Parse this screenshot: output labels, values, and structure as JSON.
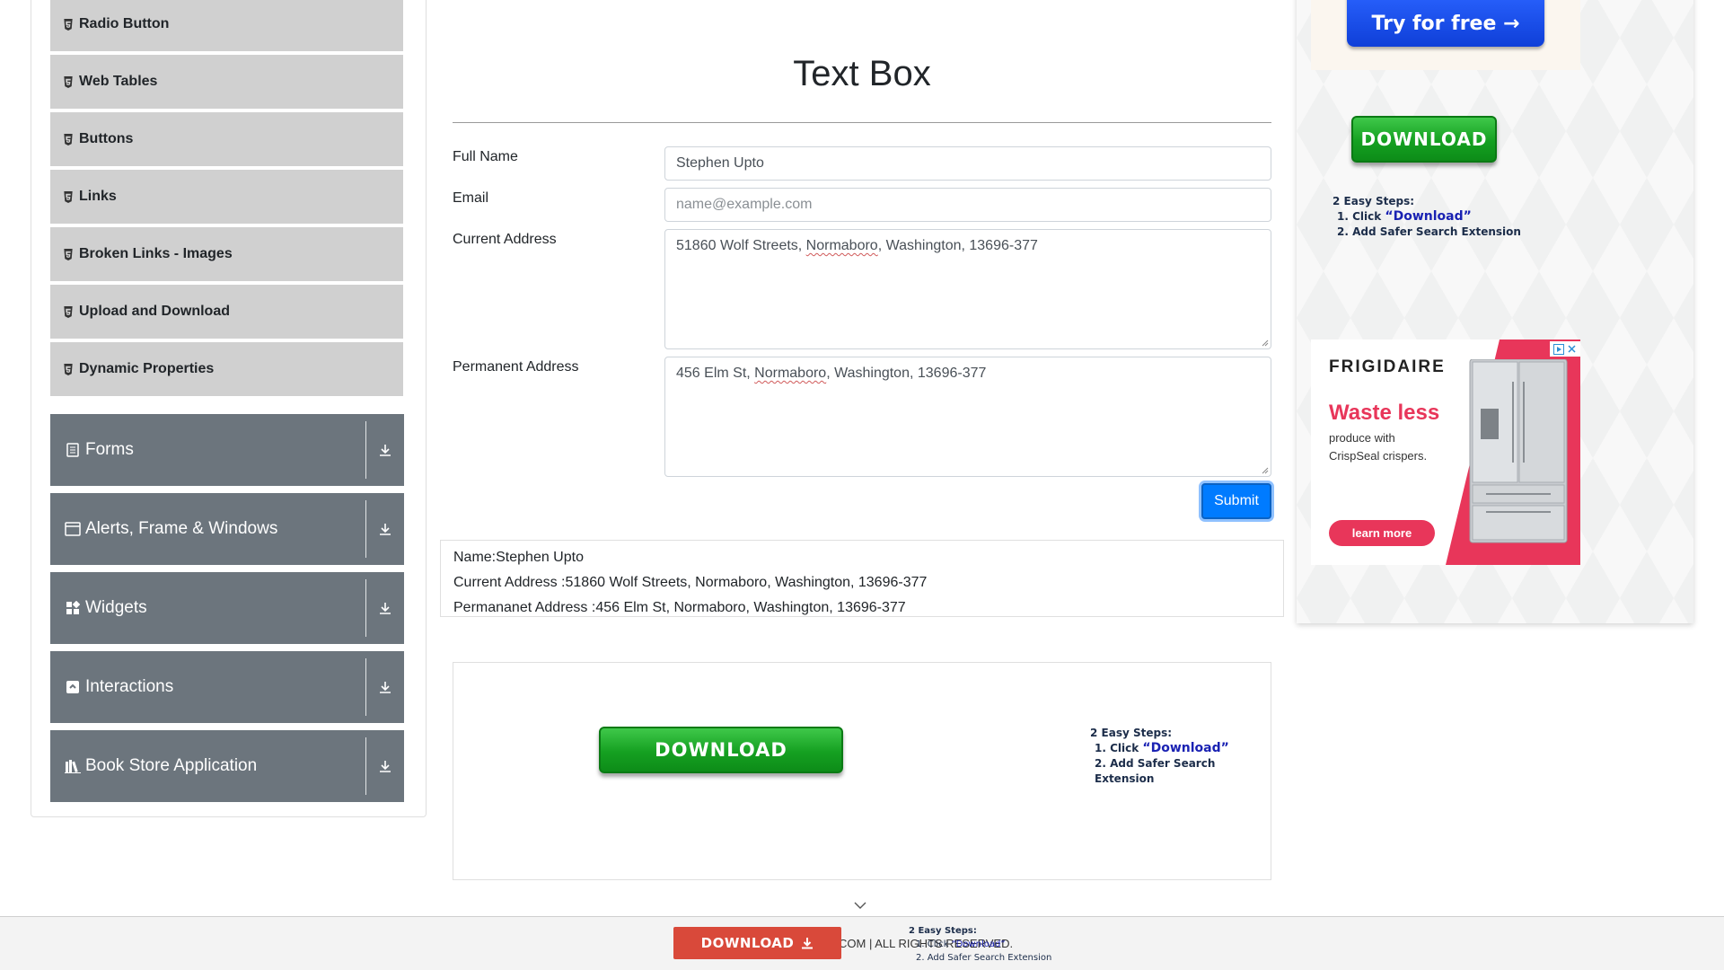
{
  "sidebar": {
    "elements_items": [
      {
        "label": "Radio Button"
      },
      {
        "label": "Web Tables"
      },
      {
        "label": "Buttons"
      },
      {
        "label": "Links"
      },
      {
        "label": "Broken Links - Images"
      },
      {
        "label": "Upload and Download"
      },
      {
        "label": "Dynamic Properties"
      }
    ],
    "groups": [
      {
        "label": "Forms",
        "icon": "document-icon"
      },
      {
        "label": "Alerts, Frame & Windows",
        "icon": "window-icon"
      },
      {
        "label": "Widgets",
        "icon": "widgets-icon"
      },
      {
        "label": "Interactions",
        "icon": "interactions-icon"
      },
      {
        "label": "Book Store Application",
        "icon": "books-icon"
      }
    ]
  },
  "main": {
    "title": "Text Box",
    "form": {
      "full_name_label": "Full Name",
      "full_name_value": "Stephen Upto",
      "email_label": "Email",
      "email_placeholder": "name@example.com",
      "current_address_label": "Current Address",
      "current_address_pre": "51860 Wolf Streets, ",
      "current_address_word": "Normaboro",
      "current_address_post": ", Washington, 13696-377",
      "permanent_address_label": "Permanent Address",
      "permanent_address_pre": "456 Elm St, ",
      "permanent_address_word": "Normaboro",
      "permanent_address_post": ", Washington, 13696-377",
      "submit_label": "Submit"
    },
    "output": {
      "name_line": "Name:Stephen Upto",
      "current_line": "Current Address :51860 Wolf Streets, Normaboro, Washington, 13696-377",
      "permanent_line": "Permananet Address :456 Elm St, Normaboro, Washington, 13696-377"
    }
  },
  "ads": {
    "download_label": "DOWNLOAD",
    "steps_title": "2 Easy Steps:",
    "step1_prefix": "1. Click ",
    "step1_link": "“Download”",
    "step2": "2. Add Safer Search Extension",
    "try_label": "Try for free →",
    "frigidaire": {
      "brand": "FRIGIDAIRE",
      "headline": "Waste less",
      "body_line1": "produce with",
      "body_line2": "CrispSeal",
      "body_line2_suffix": " crispers.",
      "cta": "learn more"
    }
  },
  "footer": {
    "text": "COM | ALL RIGHTS RESERVED.",
    "download_label": "DOWNLOAD",
    "steps_title": "2 Easy Steps:",
    "step1_prefix": "1. Click ",
    "step1_link": "“Download”",
    "step2": "2. Add Safer Search Extension"
  },
  "colors": {
    "sidebar_group_bg": "#6c757d",
    "sidebar_item_bg": "#d0d0d0",
    "submit_bg": "#007bff",
    "download_green": "#15a021",
    "footer_download_bg": "#d9493a",
    "frigidaire_accent": "#e8365a"
  }
}
